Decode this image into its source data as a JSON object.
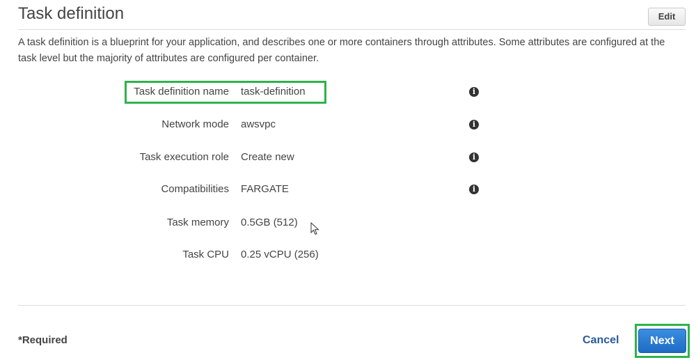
{
  "section": {
    "title": "Task definition",
    "edit_label": "Edit",
    "description": "A task definition is a blueprint for your application, and describes one or more containers through attributes. Some attributes are configured at the task level but the majority of attributes are configured per container."
  },
  "fields": [
    {
      "label": "Task definition name",
      "value": "task-definition",
      "info_icon": "info-icon"
    },
    {
      "label": "Network mode",
      "value": "awsvpc",
      "info_icon": "info-icon"
    },
    {
      "label": "Task execution role",
      "value": "Create new",
      "info_icon": "info-icon"
    },
    {
      "label": "Compatibilities",
      "value": "FARGATE",
      "info_icon": "info-icon"
    },
    {
      "label": "Task memory",
      "value": "0.5GB (512)"
    },
    {
      "label": "Task CPU",
      "value": "0.25 vCPU (256)"
    }
  ],
  "footer": {
    "required_note": "*Required",
    "cancel_label": "Cancel",
    "next_label": "Next"
  },
  "colors": {
    "highlight": "#2db34a",
    "primary_button": "#1e6bc4",
    "link": "#2b5a9b"
  }
}
